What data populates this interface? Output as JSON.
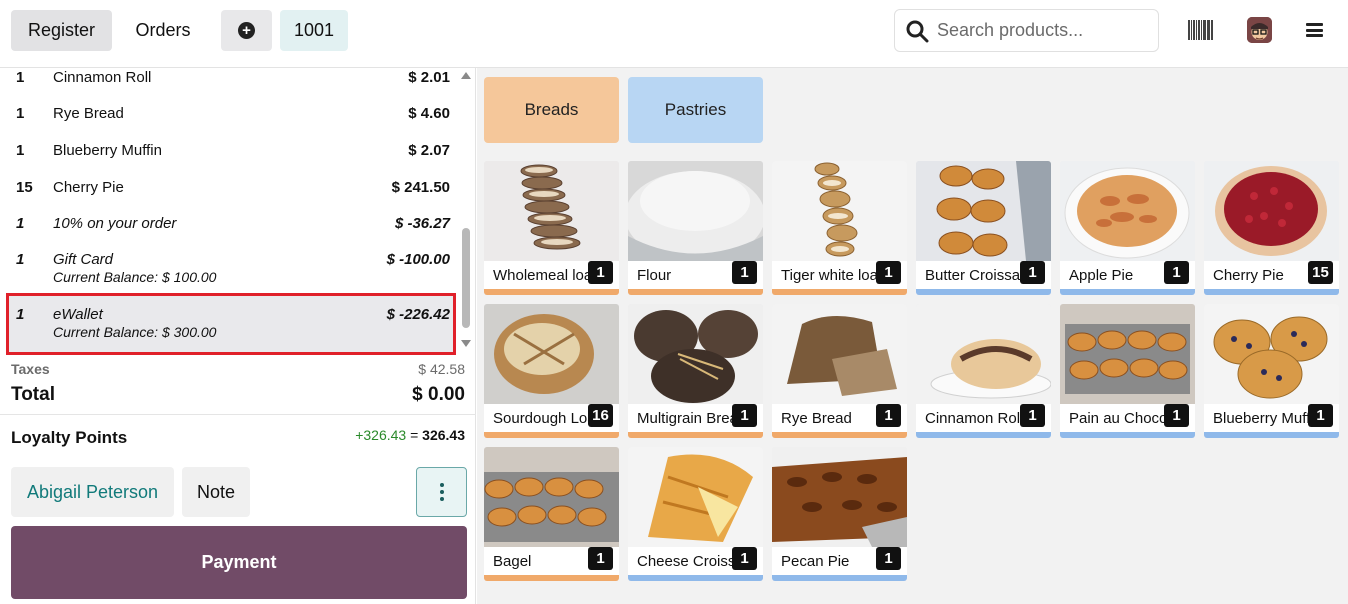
{
  "topbar": {
    "register_label": "Register",
    "orders_label": "Orders",
    "order_number": "1001",
    "search_placeholder": "Search products..."
  },
  "order_lines": [
    {
      "qty": "1",
      "name": "Cinnamon Roll",
      "price": "$ 2.01",
      "sub": ""
    },
    {
      "qty": "1",
      "name": "Rye Bread",
      "price": "$ 4.60",
      "sub": ""
    },
    {
      "qty": "1",
      "name": "Blueberry Muffin",
      "price": "$ 2.07",
      "sub": ""
    },
    {
      "qty": "15",
      "name": "Cherry Pie",
      "price": "$ 241.50",
      "sub": ""
    },
    {
      "qty": "1",
      "name": "10% on your order",
      "price": "$ -36.27",
      "sub": ""
    },
    {
      "qty": "1",
      "name": "Gift Card",
      "price": "$ -100.00",
      "sub": "Current Balance: $ 100.00"
    },
    {
      "qty": "1",
      "name": "eWallet",
      "price": "$ -226.42",
      "sub": "Current Balance: $ 300.00"
    }
  ],
  "summary": {
    "taxes_label": "Taxes",
    "taxes_value": "$ 42.58",
    "total_label": "Total",
    "total_value": "$ 0.00"
  },
  "loyalty": {
    "label": "Loyalty Points",
    "added": "+326.43",
    "equals": "=",
    "total": "326.43"
  },
  "actions": {
    "customer_label": "Abigail Peterson",
    "note_label": "Note",
    "payment_label": "Payment"
  },
  "categories": [
    {
      "label": "Breads"
    },
    {
      "label": "Pastries"
    }
  ],
  "products": [
    {
      "name": "Wholemeal loaf",
      "qty": "1",
      "category": "bread"
    },
    {
      "name": "Flour",
      "qty": "1",
      "category": "bread"
    },
    {
      "name": "Tiger white loaf",
      "qty": "1",
      "category": "bread"
    },
    {
      "name": "Butter Croissant",
      "qty": "1",
      "category": "pastry"
    },
    {
      "name": "Apple Pie",
      "qty": "1",
      "category": "pastry"
    },
    {
      "name": "Cherry Pie",
      "qty": "15",
      "category": "pastry"
    },
    {
      "name": "Sourdough Loaf",
      "qty": "16",
      "category": "bread"
    },
    {
      "name": "Multigrain Bread",
      "qty": "1",
      "category": "bread"
    },
    {
      "name": "Rye Bread",
      "qty": "1",
      "category": "bread"
    },
    {
      "name": "Cinnamon Roll",
      "qty": "1",
      "category": "pastry"
    },
    {
      "name": "Pain au Chocolat",
      "qty": "1",
      "category": "pastry"
    },
    {
      "name": "Blueberry Muffin",
      "qty": "1",
      "category": "pastry"
    },
    {
      "name": "Bagel",
      "qty": "1",
      "category": "bread"
    },
    {
      "name": "Cheese Croissant",
      "qty": "1",
      "category": "pastry"
    },
    {
      "name": "Pecan Pie",
      "qty": "1",
      "category": "pastry"
    }
  ],
  "colors": {
    "bread_bar": "#f0a96a",
    "pastry_bar": "#8fb9ea",
    "payment": "#714b67",
    "highlight": "#e0202a",
    "customer_text": "#117a7a"
  }
}
